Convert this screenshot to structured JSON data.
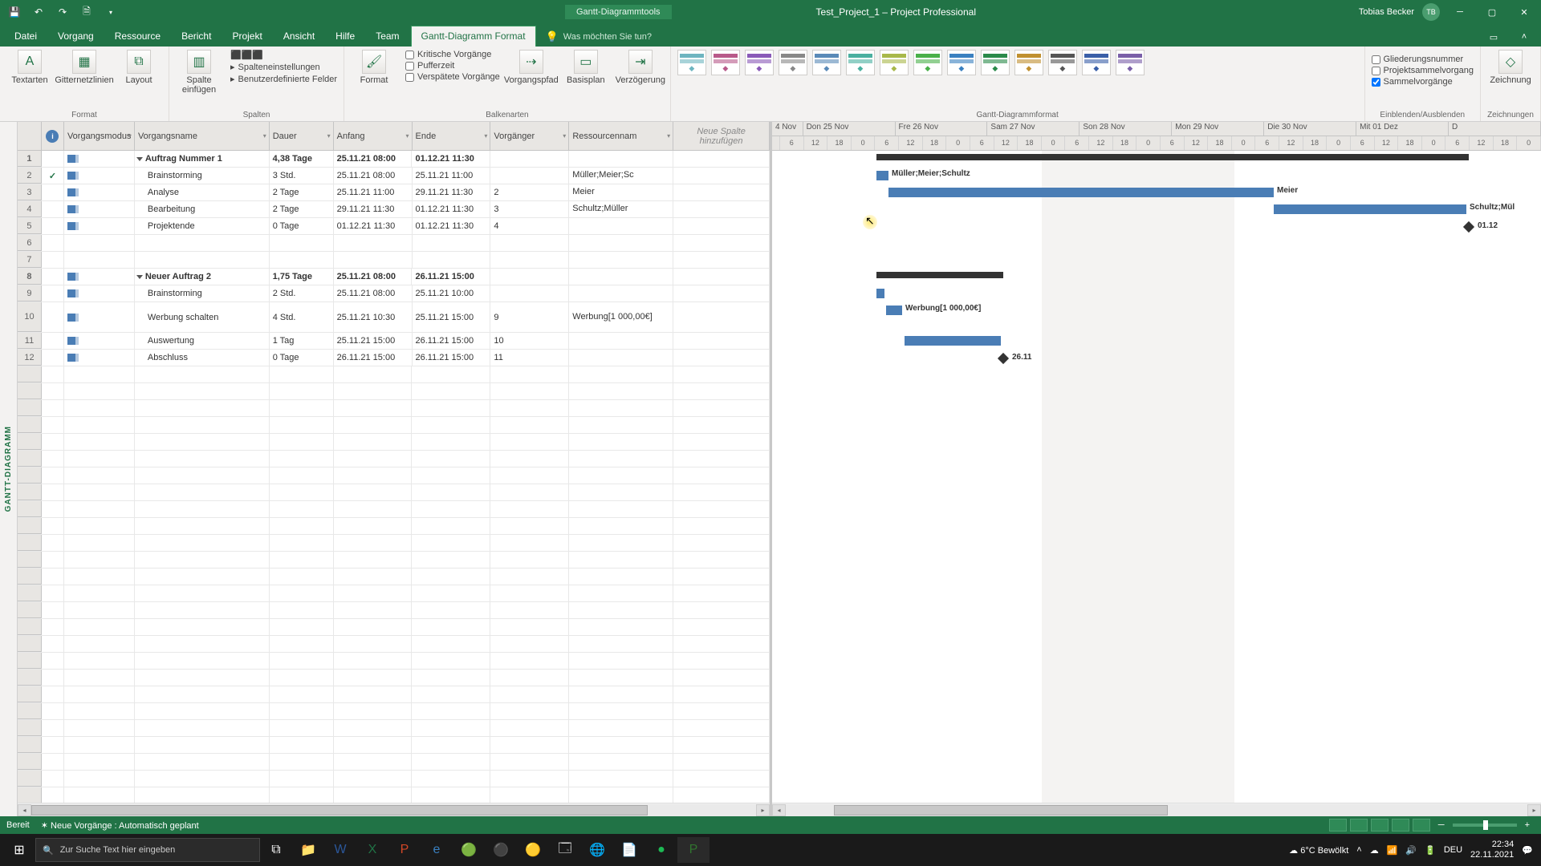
{
  "titlebar": {
    "tools_context": "Gantt-Diagrammtools",
    "document": "Test_Project_1 – Project Professional",
    "user_name": "Tobias Becker",
    "user_initials": "TB"
  },
  "tabs": {
    "datei": "Datei",
    "vorgang": "Vorgang",
    "ressource": "Ressource",
    "bericht": "Bericht",
    "projekt": "Projekt",
    "ansicht": "Ansicht",
    "hilfe": "Hilfe",
    "team": "Team",
    "format": "Gantt-Diagramm Format",
    "tellme": "Was möchten Sie tun?"
  },
  "ribbon": {
    "format_group": "Format",
    "textarten": "Textarten",
    "gitternetz": "Gitternetzlinien",
    "layout": "Layout",
    "spalten_group": "Spalten",
    "spalte_einfugen": "Spalte einfügen",
    "spalteneinst": "Spalteneinstellungen",
    "benutzerdef": "Benutzerdefinierte Felder",
    "balkenarten_group": "Balkenarten",
    "format_btn": "Format",
    "kritische": "Kritische Vorgänge",
    "pufferzeit": "Pufferzeit",
    "verspatete": "Verspätete Vorgänge",
    "vorgangspfad": "Vorgangspfad",
    "basisplan": "Basisplan",
    "verzogerung": "Verzögerung",
    "ganttformat_group": "Gantt-Diagrammformat",
    "einblenden_group": "Einblenden/Ausblenden",
    "gliederung": "Gliederungsnummer",
    "projektsammel": "Projektsammelvorgang",
    "sammelvor": "Sammelvorgänge",
    "zeichnungen_group": "Zeichnungen",
    "zeichnung": "Zeichnung"
  },
  "columns": {
    "mode": "Vorgangsmodus",
    "name": "Vorgangsname",
    "duration": "Dauer",
    "start": "Anfang",
    "end": "Ende",
    "predecessors": "Vorgänger",
    "resources": "Ressourcennam",
    "newcol": "Neue Spalte hinzufügen"
  },
  "rows": [
    {
      "n": "1",
      "info": "",
      "summary": true,
      "name": "Auftrag Nummer 1",
      "dur": "4,38 Tage",
      "start": "25.11.21 08:00",
      "end": "01.12.21 11:30",
      "pred": "",
      "res": ""
    },
    {
      "n": "2",
      "info": "check",
      "summary": false,
      "name": "Brainstorming",
      "dur": "3 Std.",
      "start": "25.11.21 08:00",
      "end": "25.11.21 11:00",
      "pred": "",
      "res": "Müller;Meier;Sc"
    },
    {
      "n": "3",
      "info": "",
      "summary": false,
      "name": "Analyse",
      "dur": "2 Tage",
      "start": "25.11.21 11:00",
      "end": "29.11.21 11:30",
      "pred": "2",
      "res": "Meier"
    },
    {
      "n": "4",
      "info": "",
      "summary": false,
      "name": "Bearbeitung",
      "dur": "2 Tage",
      "start": "29.11.21 11:30",
      "end": "01.12.21 11:30",
      "pred": "3",
      "res": "Schultz;Müller"
    },
    {
      "n": "5",
      "info": "",
      "summary": false,
      "name": "Projektende",
      "dur": "0 Tage",
      "start": "01.12.21 11:30",
      "end": "01.12.21 11:30",
      "pred": "4",
      "res": ""
    },
    {
      "n": "6",
      "info": "",
      "summary": false,
      "name": "",
      "dur": "",
      "start": "",
      "end": "",
      "pred": "",
      "res": ""
    },
    {
      "n": "7",
      "info": "",
      "summary": false,
      "name": "",
      "dur": "",
      "start": "",
      "end": "",
      "pred": "",
      "res": ""
    },
    {
      "n": "8",
      "info": "",
      "summary": true,
      "name": "Neuer Auftrag 2",
      "dur": "1,75 Tage",
      "start": "25.11.21 08:00",
      "end": "26.11.21 15:00",
      "pred": "",
      "res": ""
    },
    {
      "n": "9",
      "info": "",
      "summary": false,
      "name": "Brainstorming",
      "dur": "2 Std.",
      "start": "25.11.21 08:00",
      "end": "25.11.21 10:00",
      "pred": "",
      "res": ""
    },
    {
      "n": "10",
      "info": "",
      "summary": false,
      "name": "Werbung schalten",
      "dur": "4 Std.",
      "start": "25.11.21 10:30",
      "end": "25.11.21 15:00",
      "pred": "9",
      "res": "Werbung[1 000,00€]",
      "tall": true
    },
    {
      "n": "11",
      "info": "",
      "summary": false,
      "name": "Auswertung",
      "dur": "1 Tag",
      "start": "25.11.21 15:00",
      "end": "26.11.21 15:00",
      "pred": "10",
      "res": ""
    },
    {
      "n": "12",
      "info": "",
      "summary": false,
      "name": "Abschluss",
      "dur": "0 Tage",
      "start": "26.11.21 15:00",
      "end": "26.11.21 15:00",
      "pred": "11",
      "res": ""
    }
  ],
  "timescale_days": [
    "4 Nov",
    "Don 25 Nov",
    "Fre 26 Nov",
    "Sam 27 Nov",
    "Son 28 Nov",
    "Mon 29 Nov",
    "Die 30 Nov",
    "Mit 01 Dez",
    "D"
  ],
  "timescale_hours": [
    "6",
    "12",
    "18",
    "0",
    "6",
    "12",
    "18",
    "0",
    "6",
    "12",
    "18",
    "0",
    "6",
    "12",
    "18",
    "0",
    "6",
    "12",
    "18",
    "0",
    "6",
    "12",
    "18",
    "0",
    "6",
    "12",
    "18",
    "0",
    "6",
    "12",
    "18",
    "0"
  ],
  "gantt_labels": {
    "r2": "Müller;Meier;Schultz",
    "r3": "Meier",
    "r4": "Schultz;Mül",
    "r5": "01.12",
    "r10": "Werbung[1 000,00€]",
    "r12": "26.11"
  },
  "sidebar_label": "GANTT-DIAGRAMM",
  "statusbar": {
    "ready": "Bereit",
    "newtasks": "Neue Vorgänge : Automatisch geplant"
  },
  "taskbar": {
    "search_placeholder": "Zur Suche Text hier eingeben",
    "weather": "6°C  Bewölkt",
    "lang": "DEU",
    "time": "22:34",
    "date": "22.11.2021"
  },
  "style_colors": [
    "#6eb5c0",
    "#b85a8a",
    "#8a5ab8",
    "#888",
    "#5a8ab8",
    "#4ab0a0",
    "#a8b84a",
    "#4ab04a",
    "#3a80c0",
    "#2a8a4a",
    "#c09030",
    "#555",
    "#3a5fa8",
    "#7a5fa8"
  ]
}
